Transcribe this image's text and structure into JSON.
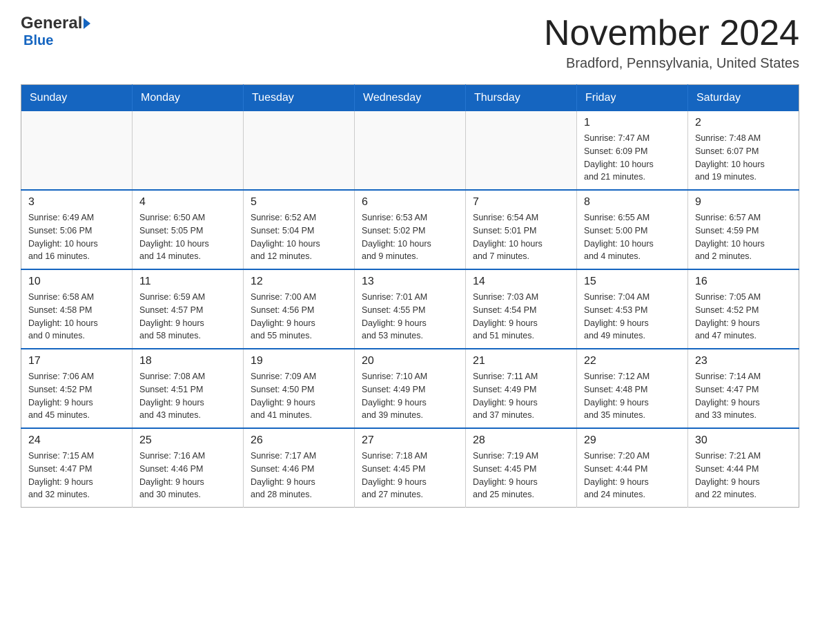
{
  "header": {
    "logo_general": "General",
    "logo_blue": "Blue",
    "month_title": "November 2024",
    "location": "Bradford, Pennsylvania, United States"
  },
  "weekdays": [
    "Sunday",
    "Monday",
    "Tuesday",
    "Wednesday",
    "Thursday",
    "Friday",
    "Saturday"
  ],
  "weeks": [
    [
      {
        "day": "",
        "info": ""
      },
      {
        "day": "",
        "info": ""
      },
      {
        "day": "",
        "info": ""
      },
      {
        "day": "",
        "info": ""
      },
      {
        "day": "",
        "info": ""
      },
      {
        "day": "1",
        "info": "Sunrise: 7:47 AM\nSunset: 6:09 PM\nDaylight: 10 hours\nand 21 minutes."
      },
      {
        "day": "2",
        "info": "Sunrise: 7:48 AM\nSunset: 6:07 PM\nDaylight: 10 hours\nand 19 minutes."
      }
    ],
    [
      {
        "day": "3",
        "info": "Sunrise: 6:49 AM\nSunset: 5:06 PM\nDaylight: 10 hours\nand 16 minutes."
      },
      {
        "day": "4",
        "info": "Sunrise: 6:50 AM\nSunset: 5:05 PM\nDaylight: 10 hours\nand 14 minutes."
      },
      {
        "day": "5",
        "info": "Sunrise: 6:52 AM\nSunset: 5:04 PM\nDaylight: 10 hours\nand 12 minutes."
      },
      {
        "day": "6",
        "info": "Sunrise: 6:53 AM\nSunset: 5:02 PM\nDaylight: 10 hours\nand 9 minutes."
      },
      {
        "day": "7",
        "info": "Sunrise: 6:54 AM\nSunset: 5:01 PM\nDaylight: 10 hours\nand 7 minutes."
      },
      {
        "day": "8",
        "info": "Sunrise: 6:55 AM\nSunset: 5:00 PM\nDaylight: 10 hours\nand 4 minutes."
      },
      {
        "day": "9",
        "info": "Sunrise: 6:57 AM\nSunset: 4:59 PM\nDaylight: 10 hours\nand 2 minutes."
      }
    ],
    [
      {
        "day": "10",
        "info": "Sunrise: 6:58 AM\nSunset: 4:58 PM\nDaylight: 10 hours\nand 0 minutes."
      },
      {
        "day": "11",
        "info": "Sunrise: 6:59 AM\nSunset: 4:57 PM\nDaylight: 9 hours\nand 58 minutes."
      },
      {
        "day": "12",
        "info": "Sunrise: 7:00 AM\nSunset: 4:56 PM\nDaylight: 9 hours\nand 55 minutes."
      },
      {
        "day": "13",
        "info": "Sunrise: 7:01 AM\nSunset: 4:55 PM\nDaylight: 9 hours\nand 53 minutes."
      },
      {
        "day": "14",
        "info": "Sunrise: 7:03 AM\nSunset: 4:54 PM\nDaylight: 9 hours\nand 51 minutes."
      },
      {
        "day": "15",
        "info": "Sunrise: 7:04 AM\nSunset: 4:53 PM\nDaylight: 9 hours\nand 49 minutes."
      },
      {
        "day": "16",
        "info": "Sunrise: 7:05 AM\nSunset: 4:52 PM\nDaylight: 9 hours\nand 47 minutes."
      }
    ],
    [
      {
        "day": "17",
        "info": "Sunrise: 7:06 AM\nSunset: 4:52 PM\nDaylight: 9 hours\nand 45 minutes."
      },
      {
        "day": "18",
        "info": "Sunrise: 7:08 AM\nSunset: 4:51 PM\nDaylight: 9 hours\nand 43 minutes."
      },
      {
        "day": "19",
        "info": "Sunrise: 7:09 AM\nSunset: 4:50 PM\nDaylight: 9 hours\nand 41 minutes."
      },
      {
        "day": "20",
        "info": "Sunrise: 7:10 AM\nSunset: 4:49 PM\nDaylight: 9 hours\nand 39 minutes."
      },
      {
        "day": "21",
        "info": "Sunrise: 7:11 AM\nSunset: 4:49 PM\nDaylight: 9 hours\nand 37 minutes."
      },
      {
        "day": "22",
        "info": "Sunrise: 7:12 AM\nSunset: 4:48 PM\nDaylight: 9 hours\nand 35 minutes."
      },
      {
        "day": "23",
        "info": "Sunrise: 7:14 AM\nSunset: 4:47 PM\nDaylight: 9 hours\nand 33 minutes."
      }
    ],
    [
      {
        "day": "24",
        "info": "Sunrise: 7:15 AM\nSunset: 4:47 PM\nDaylight: 9 hours\nand 32 minutes."
      },
      {
        "day": "25",
        "info": "Sunrise: 7:16 AM\nSunset: 4:46 PM\nDaylight: 9 hours\nand 30 minutes."
      },
      {
        "day": "26",
        "info": "Sunrise: 7:17 AM\nSunset: 4:46 PM\nDaylight: 9 hours\nand 28 minutes."
      },
      {
        "day": "27",
        "info": "Sunrise: 7:18 AM\nSunset: 4:45 PM\nDaylight: 9 hours\nand 27 minutes."
      },
      {
        "day": "28",
        "info": "Sunrise: 7:19 AM\nSunset: 4:45 PM\nDaylight: 9 hours\nand 25 minutes."
      },
      {
        "day": "29",
        "info": "Sunrise: 7:20 AM\nSunset: 4:44 PM\nDaylight: 9 hours\nand 24 minutes."
      },
      {
        "day": "30",
        "info": "Sunrise: 7:21 AM\nSunset: 4:44 PM\nDaylight: 9 hours\nand 22 minutes."
      }
    ]
  ]
}
